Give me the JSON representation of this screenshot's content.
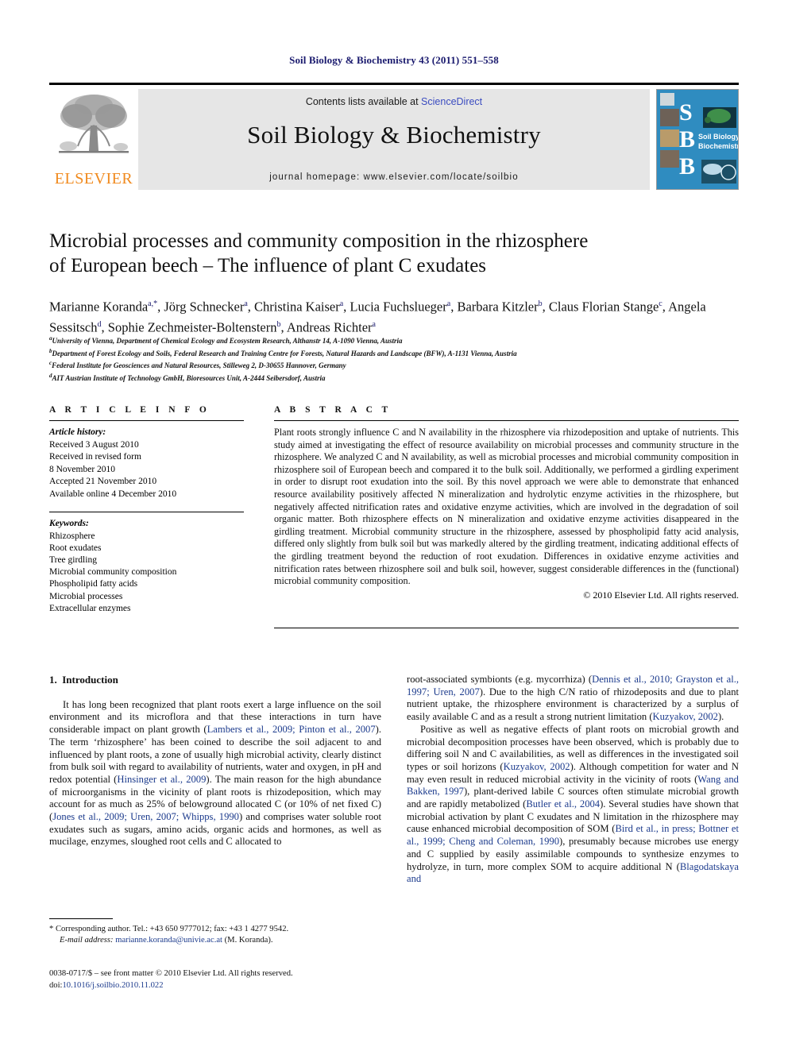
{
  "running_head": "Soil Biology & Biochemistry 43 (2011) 551–558",
  "masthead": {
    "publisher_name": "ELSEVIER",
    "contents_prefix": "Contents lists available at ",
    "sciencedirect": "ScienceDirect",
    "journal_title": "Soil Biology & Biochemistry",
    "homepage": "journal homepage: www.elsevier.com/locate/soilbio",
    "cover_letters": [
      "S",
      "B",
      "B"
    ],
    "cover_title_line1": "Soil Biology &",
    "cover_title_line2": "Biochemistry",
    "colors": {
      "band": "#e6e6e6",
      "elsevier_orange": "#f08a1e",
      "sciencedirect_blue": "#3b4cc0",
      "cover_blue": "#2e8bbe"
    }
  },
  "article": {
    "title_line1": "Microbial processes and community composition in the rhizosphere",
    "title_line2": "of European beech – The influence of plant C exudates",
    "authors": [
      {
        "name": "Marianne Koranda",
        "sup": "a,*"
      },
      {
        "name": "Jörg Schnecker",
        "sup": "a"
      },
      {
        "name": "Christina Kaiser",
        "sup": "a"
      },
      {
        "name": "Lucia Fuchslueger",
        "sup": "a"
      },
      {
        "name": "Barbara Kitzler",
        "sup": "b"
      },
      {
        "name": "Claus Florian Stange",
        "sup": "c"
      },
      {
        "name": "Angela Sessitsch",
        "sup": "d"
      },
      {
        "name": "Sophie Zechmeister-Boltenstern",
        "sup": "b"
      },
      {
        "name": "Andreas Richter",
        "sup": "a"
      }
    ],
    "affiliations": [
      {
        "sup": "a",
        "text": "University of Vienna, Department of Chemical Ecology and Ecosystem Research, Althanstr 14, A-1090 Vienna, Austria"
      },
      {
        "sup": "b",
        "text": "Department of Forest Ecology and Soils, Federal Research and Training Centre for Forests, Natural Hazards and Landscape (BFW), A-1131 Vienna, Austria"
      },
      {
        "sup": "c",
        "text": "Federal Institute for Geosciences and Natural Resources, Stilleweg 2, D-30655 Hannover, Germany"
      },
      {
        "sup": "d",
        "text": "AIT Austrian Institute of Technology GmbH, Bioresources Unit, A-2444 Seibersdorf, Austria"
      }
    ]
  },
  "article_info": {
    "heading": "A R T I C L E   I N F O",
    "history_label": "Article history:",
    "history": [
      "Received 3 August 2010",
      "Received in revised form",
      "8 November 2010",
      "Accepted 21 November 2010",
      "Available online 4 December 2010"
    ],
    "keywords_label": "Keywords:",
    "keywords": [
      "Rhizosphere",
      "Root exudates",
      "Tree girdling",
      "Microbial community composition",
      "Phospholipid fatty acids",
      "Microbial processes",
      "Extracellular enzymes"
    ]
  },
  "abstract": {
    "heading": "A B S T R A C T",
    "text": "Plant roots strongly influence C and N availability in the rhizosphere via rhizodeposition and uptake of nutrients. This study aimed at investigating the effect of resource availability on microbial processes and community structure in the rhizosphere. We analyzed C and N availability, as well as microbial processes and microbial community composition in rhizosphere soil of European beech and compared it to the bulk soil. Additionally, we performed a girdling experiment in order to disrupt root exudation into the soil. By this novel approach we were able to demonstrate that enhanced resource availability positively affected N mineralization and hydrolytic enzyme activities in the rhizosphere, but negatively affected nitrification rates and oxidative enzyme activities, which are involved in the degradation of soil organic matter. Both rhizosphere effects on N mineralization and oxidative enzyme activities disappeared in the girdling treatment. Microbial community structure in the rhizosphere, assessed by phospholipid fatty acid analysis, differed only slightly from bulk soil but was markedly altered by the girdling treatment, indicating additional effects of the girdling treatment beyond the reduction of root exudation. Differences in oxidative enzyme activities and nitrification rates between rhizosphere soil and bulk soil, however, suggest considerable differences in the (functional) microbial community composition.",
    "copyright": "© 2010 Elsevier Ltd. All rights reserved."
  },
  "body": {
    "section_number": "1.",
    "section_title": "Introduction",
    "left_paragraphs": [
      {
        "segments": [
          {
            "t": "It has long been recognized that plant roots exert a large influence on the soil environment and its microflora and that these interactions in turn have considerable impact on plant growth (",
            "ref": false
          },
          {
            "t": "Lambers et al., 2009; Pinton et al., 2007",
            "ref": true
          },
          {
            "t": "). The term ‘rhizosphere’ has been coined to describe the soil adjacent to and influenced by plant roots, a zone of usually high microbial activity, clearly distinct from bulk soil with regard to availability of nutrients, water and oxygen, in pH and redox potential (",
            "ref": false
          },
          {
            "t": "Hinsinger et al., 2009",
            "ref": true
          },
          {
            "t": "). The main reason for the high abundance of microorganisms in the vicinity of plant roots is rhizodeposition, which may account for as much as 25% of belowground allocated C (or 10% of net fixed C) (",
            "ref": false
          },
          {
            "t": "Jones et al., 2009; Uren, 2007; Whipps, 1990",
            "ref": true
          },
          {
            "t": ") and comprises water soluble root exudates such as sugars, amino acids, organic acids and hormones, as well as mucilage, enzymes, sloughed root cells and C allocated to",
            "ref": false
          }
        ]
      }
    ],
    "right_paragraphs": [
      {
        "segments": [
          {
            "t": "root-associated symbionts (e.g. mycorrhiza) (",
            "ref": false
          },
          {
            "t": "Dennis et al., 2010; Grayston et al., 1997; Uren, 2007",
            "ref": true
          },
          {
            "t": "). Due to the high C/N ratio of rhizodeposits and due to plant nutrient uptake, the rhizosphere environment is characterized by a surplus of easily available C and as a result a strong nutrient limitation (",
            "ref": false
          },
          {
            "t": "Kuzyakov, 2002",
            "ref": true
          },
          {
            "t": ").",
            "ref": false
          }
        ],
        "indent": false
      },
      {
        "segments": [
          {
            "t": "Positive as well as negative effects of plant roots on microbial growth and microbial decomposition processes have been observed, which is probably due to differing soil N and C availabilities, as well as differences in the investigated soil types or soil horizons (",
            "ref": false
          },
          {
            "t": "Kuzyakov, 2002",
            "ref": true
          },
          {
            "t": "). Although competition for water and N may even result in reduced microbial activity in the vicinity of roots (",
            "ref": false
          },
          {
            "t": "Wang and Bakken, 1997",
            "ref": true
          },
          {
            "t": "), plant-derived labile C sources often stimulate microbial growth and are rapidly metabolized (",
            "ref": false
          },
          {
            "t": "Butler et al., 2004",
            "ref": true
          },
          {
            "t": "). Several studies have shown that microbial activation by plant C exudates and N limitation in the rhizosphere may cause enhanced microbial decomposition of SOM (",
            "ref": false
          },
          {
            "t": "Bird et al., in press; Bottner et al., 1999; Cheng and Coleman, 1990",
            "ref": true
          },
          {
            "t": "), presumably because microbes use energy and C supplied by easily assimilable compounds to synthesize enzymes to hydrolyze, in turn, more complex SOM to acquire additional N (",
            "ref": false
          },
          {
            "t": "Blagodatskaya and",
            "ref": true
          }
        ],
        "indent": true
      }
    ]
  },
  "footnotes": {
    "corresponding": "* Corresponding author. Tel.: +43 650 9777012; fax: +43 1 4277 9542.",
    "email_label": "E-mail address:",
    "email": "marianne.koranda@univie.ac.at",
    "email_suffix": "(M. Koranda).",
    "issn_line": "0038-0717/$ – see front matter © 2010 Elsevier Ltd. All rights reserved.",
    "doi_label": "doi:",
    "doi": "10.1016/j.soilbio.2010.11.022"
  }
}
